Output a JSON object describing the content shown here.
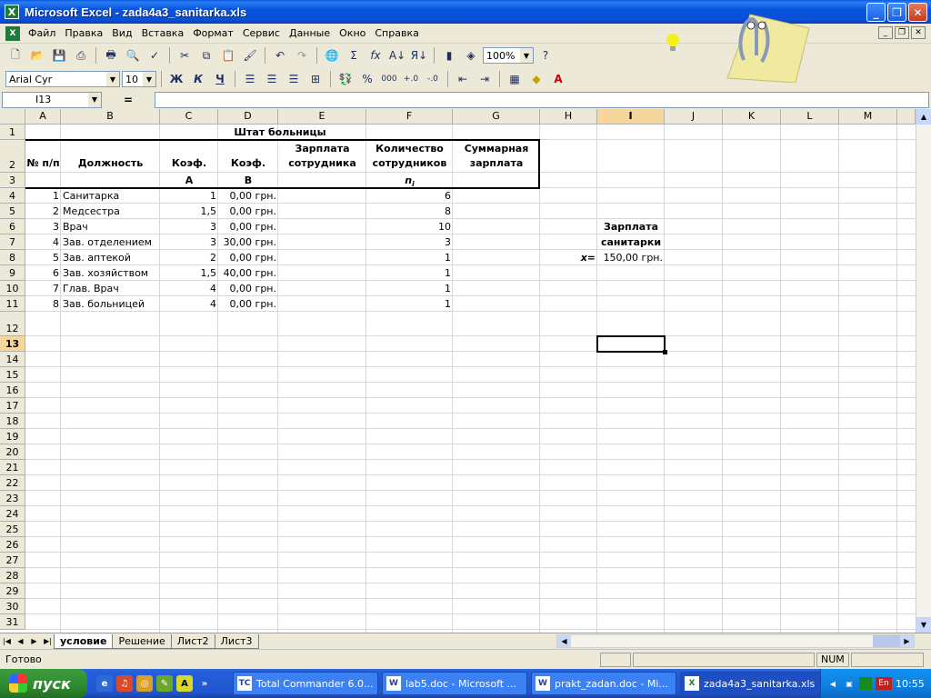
{
  "window": {
    "title": "Microsoft Excel - zada4a3_sanitarka.xls"
  },
  "menu": [
    "Файл",
    "Правка",
    "Вид",
    "Вставка",
    "Формат",
    "Сервис",
    "Данные",
    "Окно",
    "Справка"
  ],
  "toolbar": {
    "zoom": "100%"
  },
  "format_toolbar": {
    "font": "Arial Cyr",
    "size": "10",
    "bold": "Ж",
    "italic": "К",
    "underline": "Ч",
    "percent": "%",
    "thousands": "000"
  },
  "formula_bar": {
    "name_box": "I13",
    "equals": "=",
    "value": ""
  },
  "columns": [
    "A",
    "B",
    "C",
    "D",
    "E",
    "F",
    "G",
    "H",
    "I",
    "J",
    "K",
    "L",
    "M"
  ],
  "rows": [
    "1",
    "2",
    "3",
    "4",
    "5",
    "6",
    "7",
    "8",
    "9",
    "10",
    "11",
    "12",
    "13",
    "14",
    "15",
    "16",
    "17",
    "18",
    "19",
    "20",
    "21",
    "22",
    "23",
    "24",
    "25",
    "26",
    "27",
    "28",
    "29",
    "30",
    "31"
  ],
  "sheet": {
    "title": "Штат больницы",
    "headers": {
      "num": "№ п/п",
      "position": "Должность",
      "coef1": "Коэф.",
      "coef2": "Коэф.",
      "salary_l1": "Зарплата",
      "salary_l2": "сотрудника",
      "count_l1": "Количество",
      "count_l2": "сотрудников",
      "total_l1": "Суммарная",
      "total_l2": "зарплата",
      "coef1_sub": "A",
      "coef2_sub": "B",
      "count_sub": "n"
    },
    "table": [
      {
        "n": "1",
        "name": "Санитарка",
        "a": "1",
        "b": "0,00 грн.",
        "count": "6"
      },
      {
        "n": "2",
        "name": "Медсестра",
        "a": "1,5",
        "b": "0,00 грн.",
        "count": "8"
      },
      {
        "n": "3",
        "name": "Врач",
        "a": "3",
        "b": "0,00 грн.",
        "count": "10"
      },
      {
        "n": "4",
        "name": "Зав. отделением",
        "a": "3",
        "b": "30,00 грн.",
        "count": "3"
      },
      {
        "n": "5",
        "name": "Зав. аптекой",
        "a": "2",
        "b": "0,00 грн.",
        "count": "1"
      },
      {
        "n": "6",
        "name": "Зав. хозяйством",
        "a": "1,5",
        "b": "40,00 грн.",
        "count": "1"
      },
      {
        "n": "7",
        "name": "Глав. Врач",
        "a": "4",
        "b": "0,00 грн.",
        "count": "1"
      },
      {
        "n": "8",
        "name": "Зав. больницей",
        "a": "4",
        "b": "0,00 грн.",
        "count": "1"
      }
    ],
    "side": {
      "label_l1": "Зарплата",
      "label_l2": "санитарки",
      "x_label": "x=",
      "x_value": "150,00 грн."
    }
  },
  "tabs": [
    "условие",
    "Решение",
    "Лист2",
    "Лист3"
  ],
  "active_tab": "условие",
  "status": {
    "text": "Готово",
    "num": "NUM"
  },
  "taskbar": {
    "start": "пуск",
    "items": [
      "Total Commander 6.0...",
      "lab5.doc - Microsoft ...",
      "prakt_zadan.doc - Mi...",
      "zada4a3_sanitarka.xls"
    ],
    "lang": "En",
    "clock": "10:55"
  }
}
